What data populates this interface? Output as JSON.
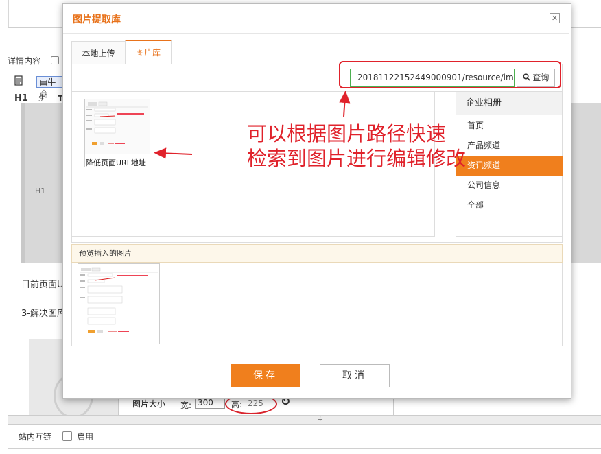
{
  "background": {
    "detail_label": "详情内容",
    "detail_extra": "F",
    "toolbar_icon": "document-icon",
    "toolbar_button": "牛商",
    "heading_tool": "H1",
    "font_tool": "ℱ",
    "text_tool": "T",
    "editor_h1_placeholder": "H1",
    "paragraph_current_url": "目前页面U",
    "paragraph_step3": "3-解决图库",
    "image_size_label": "图片大小",
    "width_label": "宽:",
    "width_value": "300",
    "height_label": "高:",
    "height_value": "225",
    "refresh_icon": "refresh-icon",
    "link_label": "站内互链",
    "link_enable_label": "启用"
  },
  "modal": {
    "title": "图片提取库",
    "close_icon": "close-icon",
    "tabs": [
      {
        "label": "本地上传",
        "active": false
      },
      {
        "label": "图片库",
        "active": true
      }
    ],
    "search": {
      "value": "20181122152449000901/resource/image",
      "button_label": "查询",
      "button_icon": "search-icon"
    },
    "images": [
      {
        "caption": "降低页面URL地址"
      }
    ],
    "albums": {
      "header": "企业相册",
      "items": [
        {
          "label": "首页",
          "active": false
        },
        {
          "label": "产品频道",
          "active": false
        },
        {
          "label": "资讯频道",
          "active": true
        },
        {
          "label": "公司信息",
          "active": false
        },
        {
          "label": "全部",
          "active": false
        }
      ]
    },
    "preview_header": "预览插入的图片",
    "save_label": "保存",
    "cancel_label": "取消"
  },
  "annotation": {
    "line1": "可以根据图片路径快速",
    "line2": "检索到图片进行编辑修改"
  },
  "colors": {
    "accent_orange": "#f07f1d",
    "title_orange": "#e8731c",
    "annotation_red": "#e0222b",
    "search_border_green": "#4caf50"
  }
}
